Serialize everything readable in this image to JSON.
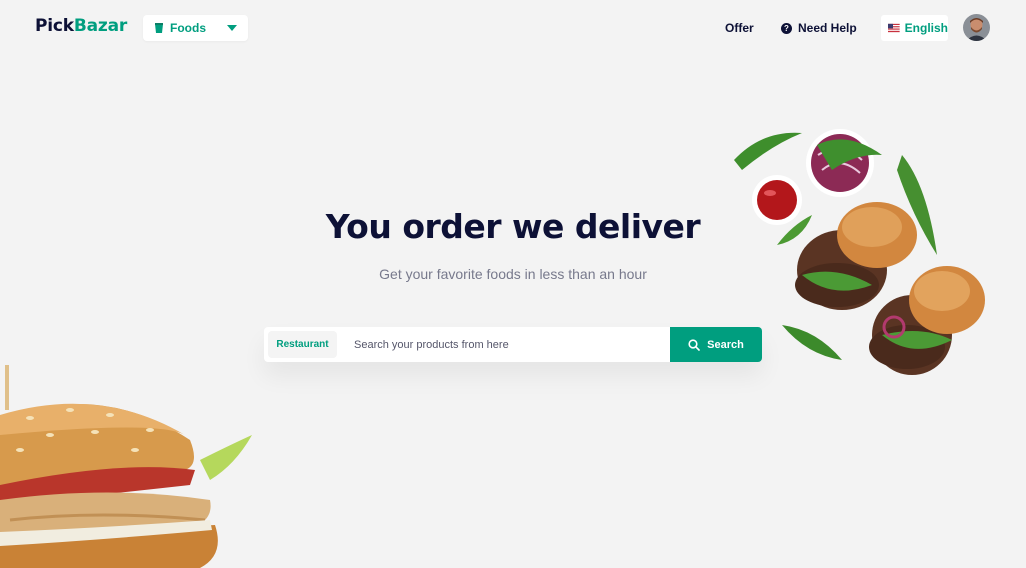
{
  "header": {
    "logo": {
      "pick": "Pick",
      "bazar": "Bazar"
    },
    "category_select": {
      "label": "Foods",
      "icon": "cup-icon"
    },
    "nav": {
      "offer": "Offer",
      "need_help": "Need Help"
    },
    "language": {
      "label": "English",
      "flag": "us-flag-icon"
    },
    "avatar": "user-avatar"
  },
  "hero": {
    "title": "You order we deliver",
    "subtitle": "Get your favorite foods in less than an hour"
  },
  "search": {
    "category_label": "Restaurant",
    "placeholder": "Search your products from here",
    "button_label": "Search"
  },
  "colors": {
    "accent": "#009e7f",
    "heading": "#0d1136",
    "muted": "#77798c",
    "background": "#f3f3f3"
  }
}
